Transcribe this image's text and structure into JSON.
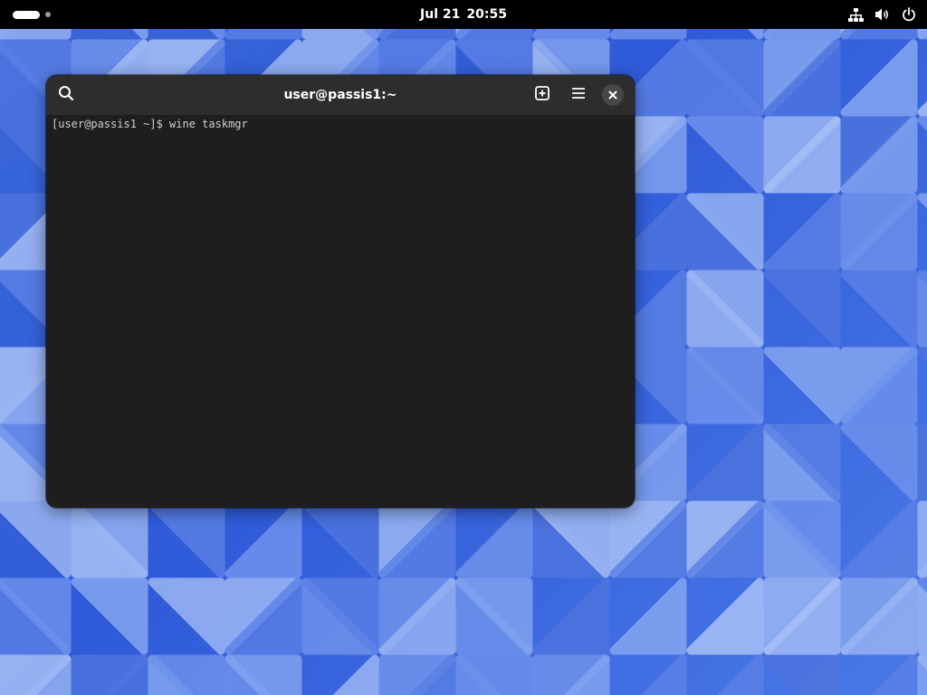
{
  "top_bar": {
    "clock_date": "Jul 21",
    "clock_time": "20:55",
    "icons": [
      "network-icon",
      "volume-icon",
      "power-icon"
    ]
  },
  "workspaces": {
    "count": 2,
    "active": 1
  },
  "terminal": {
    "title": "user@passis1:~",
    "prompt": "[user@passis1 ~]$ ",
    "command": "wine taskmgr",
    "header_icons": [
      "search-icon",
      "new-tab-icon",
      "hamburger-menu-icon",
      "close-icon"
    ]
  },
  "colors": {
    "top_bar": "#000000",
    "terminal_bg": "#1e1e1e",
    "header_bg": "#2d2d2d",
    "wallpaper_blue": "#3a66d8",
    "text": "#ffffff"
  }
}
